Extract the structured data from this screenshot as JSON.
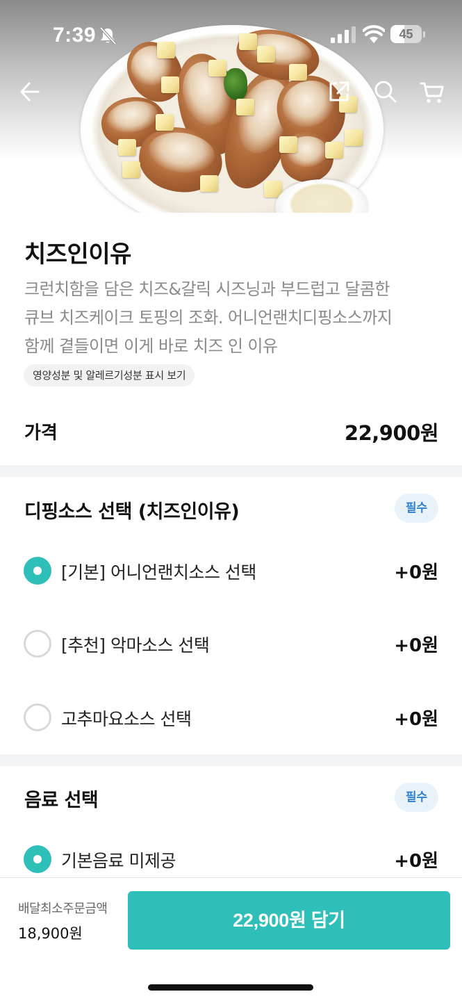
{
  "status_bar": {
    "time": "7:39",
    "battery_level": "45",
    "battery_fraction": 0.45,
    "icons": [
      "bell-slash-icon",
      "signal-icon",
      "wifi-icon",
      "battery-icon"
    ]
  },
  "nav": {
    "icons": [
      "back-arrow-icon",
      "share-icon",
      "search-icon",
      "cart-icon"
    ]
  },
  "product": {
    "name": "치즈인이유",
    "description_lines": [
      "크런치함을 담은 치즈&갈릭 시즈닝과 부드럽고 달콤한",
      "큐브 치즈케이크 토핑의 조화. 어니언랜치디핑소스까지",
      "함께 곁들이면 이게 바로 치즈 인 이유"
    ],
    "nutrition_link": "영양성분 및 알레르기성분 표시 보기",
    "price_label": "가격",
    "price": "22,900원"
  },
  "sections": [
    {
      "title": "디핑소스 선택 (치즈인이유)",
      "badge": "필수",
      "options": [
        {
          "label": "[기본] 어니언랜치소스 선택",
          "price": "+0원",
          "selected": true
        },
        {
          "label": "[추천] 악마소스 선택",
          "price": "+0원",
          "selected": false
        },
        {
          "label": "고추마요소스 선택",
          "price": "+0원",
          "selected": false
        }
      ]
    },
    {
      "title": "음료 선택",
      "badge": "필수",
      "options": [
        {
          "label": "기본음료 미제공",
          "price": "+0원",
          "selected": true
        }
      ]
    }
  ],
  "bottom_bar": {
    "min_order_label": "배달최소주문금액",
    "min_order_value": "18,900원",
    "add_button": "22,900원 담기"
  },
  "colors": {
    "accent": "#2fbfb9",
    "badge_bg": "#e7f2fb",
    "badge_text": "#2f7fd0",
    "divider": "#f2f3f5"
  }
}
